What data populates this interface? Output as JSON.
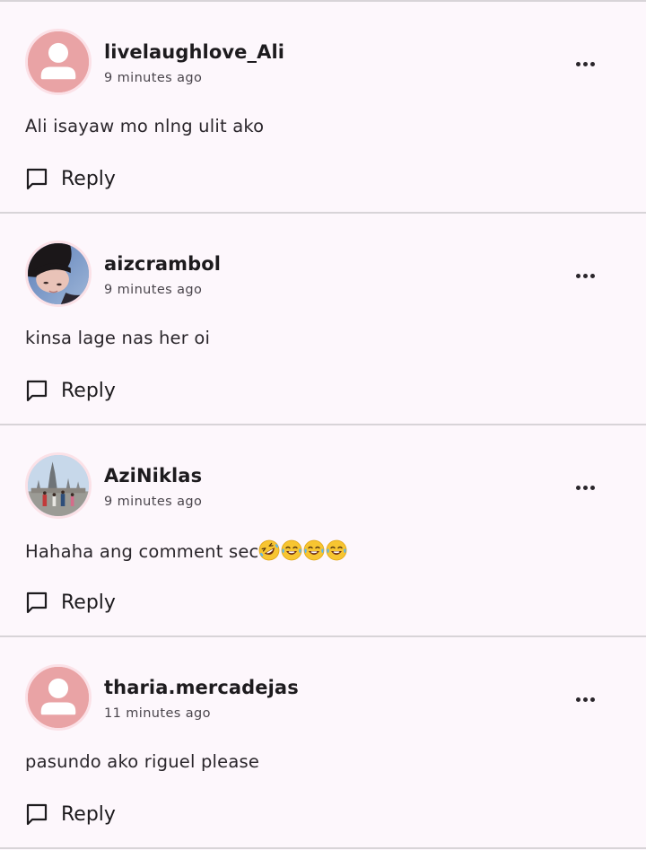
{
  "comments": [
    {
      "username": "livelaughlove_Ali",
      "time": "9 minutes ago",
      "text": "Ali isayaw mo nlng ulit ako",
      "avatar": "default-person-avatar",
      "reply_label": "Reply"
    },
    {
      "username": "aizcrambol",
      "time": "9 minutes ago",
      "text": "kinsa lage nas her oi",
      "avatar": "profile-photo",
      "reply_label": "Reply"
    },
    {
      "username": "AziNiklas",
      "time": "9 minutes ago",
      "text": "Hahaha ang comment sec",
      "emoji": [
        "rolling-on-floor-laughing",
        "tears-of-joy",
        "tears-of-joy",
        "tears-of-joy"
      ],
      "avatar": "landscape-photo",
      "reply_label": "Reply"
    },
    {
      "username": "tharia.mercadejas",
      "time": "11 minutes ago",
      "text": "pasundo ako riguel please",
      "avatar": "default-person-avatar",
      "reply_label": "Reply"
    }
  ],
  "colors": {
    "background": "#fdf7fc",
    "divider": "#d8d4d8",
    "default_avatar": "#e9a3a5",
    "avatar_ring": "#fbe1e7"
  }
}
